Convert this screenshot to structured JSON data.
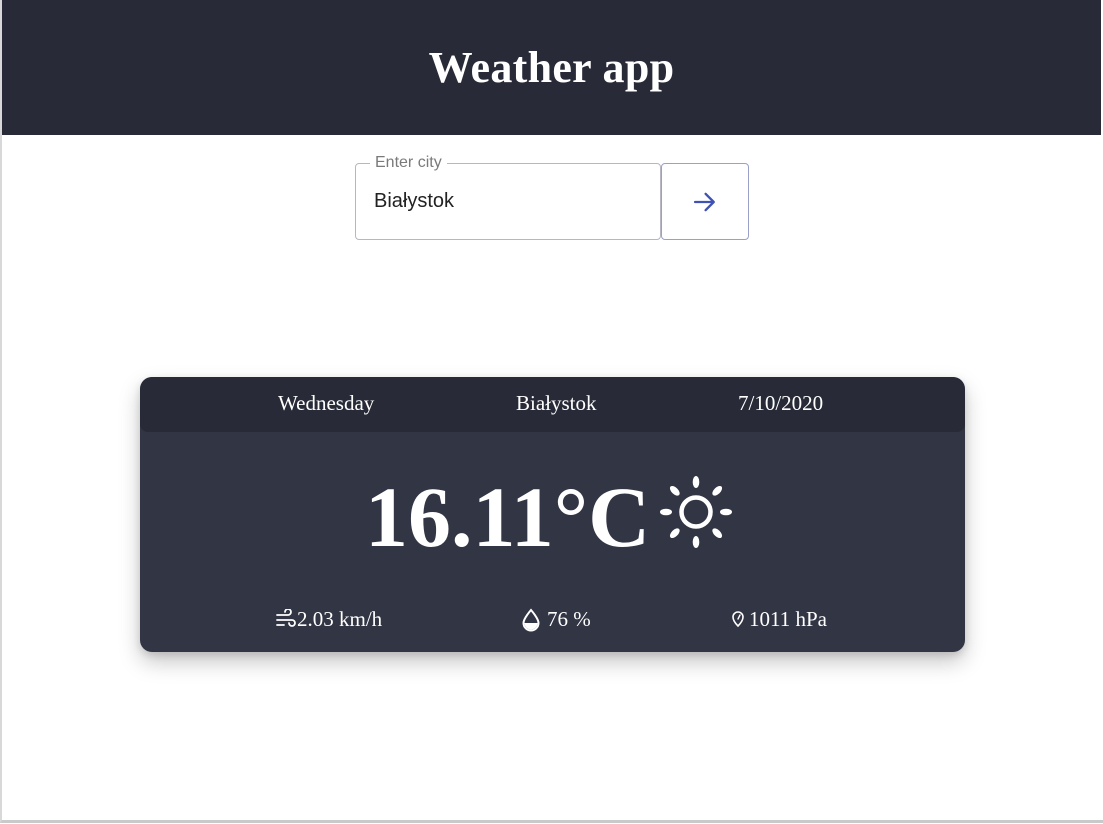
{
  "app": {
    "title": "Weather app"
  },
  "search": {
    "label": "Enter city",
    "value": "Białystok",
    "submit_icon": "arrow-right-icon"
  },
  "weather": {
    "day": "Wednesday",
    "city": "Białystok",
    "date": "7/10/2020",
    "temperature": "16.11°C",
    "condition_icon": "sun-icon",
    "wind": "2.03 km/h",
    "humidity": "76 %",
    "pressure": "1011 hPa"
  },
  "colors": {
    "header_bg": "#282b37",
    "card_bg": "#323544",
    "accent": "#3f51b5",
    "text_light": "#ffffff"
  }
}
